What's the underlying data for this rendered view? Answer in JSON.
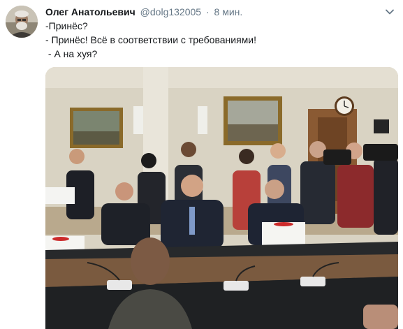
{
  "tweet": {
    "author_name": "Олег Анатольевич",
    "author_handle": "@dolg132005",
    "separator": "·",
    "time": "8 мин.",
    "text_lines": [
      "-Принёс?",
      "- Принёс! Всё в соответствии с требованиями!",
      " - А на хуя?"
    ],
    "icons": {
      "more": "chevron-down-icon",
      "avatar": "avatar"
    },
    "colors": {
      "text": "#14171a",
      "secondary": "#657786"
    }
  }
}
